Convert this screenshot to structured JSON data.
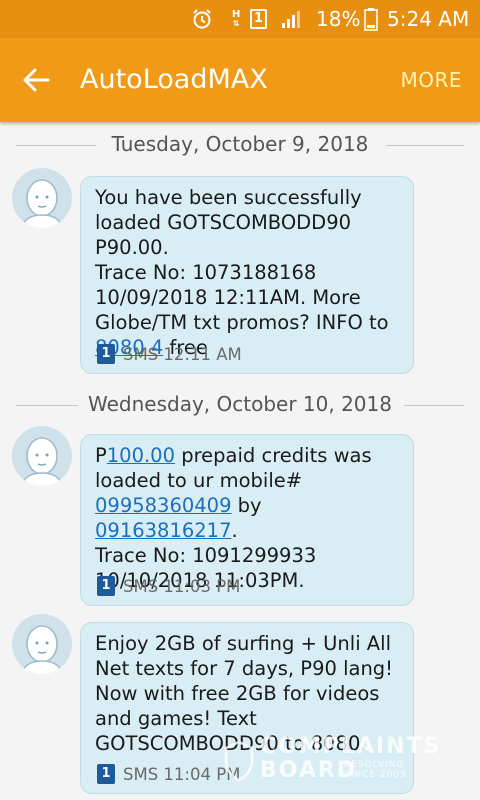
{
  "status_bar": {
    "network_badge": "1",
    "network_type": "H",
    "battery": "18%",
    "time": "5:24 AM"
  },
  "app_bar": {
    "title": "AutoLoadMAX",
    "more_label": "MORE"
  },
  "conversation": {
    "dates": [
      "Tuesday, October 9, 2018",
      "Wednesday, October 10, 2018"
    ],
    "messages": [
      {
        "text_a": "You have been successfully\nloaded GOTSCOMBODD90 P90.00.\nTrace No: 1073188168\n10/09/2018 12:11AM. More\nGlobe/TM txt promos? INFO to\n",
        "link_1": "8080 4",
        "text_b": " free",
        "sim": "1",
        "meta": "SMS 12:11 AM"
      },
      {
        "text_a": "P",
        "link_1": "100.00",
        "text_b": " prepaid credits was\nloaded to ur mobile#\n",
        "link_2": "09958360409",
        "text_c": " by ",
        "link_3": "09163816217",
        "text_d": ".\nTrace No: 1091299933\n10/10/2018 11:03PM.",
        "sim": "1",
        "meta": "SMS 11:03 PM"
      },
      {
        "text_a": "Enjoy 2GB of surfing + Unli All\nNet texts for 7 days, P90 lang!\nNow with free 2GB for videos\nand games! Text\nGOTSCOMBODD90 to 8080.",
        "sim": "1",
        "meta": "SMS 11:04 PM"
      }
    ]
  },
  "watermark": {
    "line1": "COMPLAINTS",
    "line2": "BOARD",
    "tagline": "RESOLVING\nSINCE 2005"
  },
  "colors": {
    "app_bar": "#f09a17",
    "status_bar": "#e88f10",
    "bubble": "#d9eef4",
    "link": "#1a6fbf",
    "more": "#fff3b0"
  }
}
